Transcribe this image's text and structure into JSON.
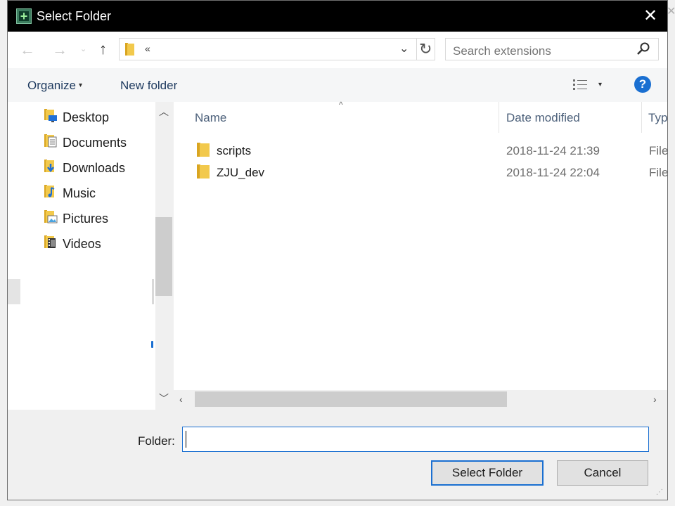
{
  "window": {
    "title": "Select Folder",
    "close_glyph": "✕",
    "app_icon": "plus-icon"
  },
  "nav": {
    "back_glyph": "←",
    "forward_glyph": "→",
    "recent_glyph": "⌄",
    "up_glyph": "↑",
    "address_chevron": "«",
    "address_dropdown_glyph": "⌄",
    "refresh_glyph": "↻",
    "search_placeholder": "Search extensions"
  },
  "toolbar": {
    "organize_label": "Organize",
    "organize_caret": "▾",
    "new_folder_label": "New folder",
    "view_caret": "▾",
    "help_label": "?"
  },
  "navpane": {
    "items": [
      {
        "label": "Desktop",
        "icon": "desktop-icon"
      },
      {
        "label": "Documents",
        "icon": "documents-icon"
      },
      {
        "label": "Downloads",
        "icon": "downloads-icon"
      },
      {
        "label": "Music",
        "icon": "music-icon"
      },
      {
        "label": "Pictures",
        "icon": "pictures-icon"
      },
      {
        "label": "Videos",
        "icon": "videos-icon"
      }
    ],
    "scroll_up_glyph": "︿",
    "scroll_down_glyph": "﹀"
  },
  "content": {
    "columns": {
      "name": "Name",
      "sort_caret": "^",
      "date": "Date modified",
      "type": "Typ"
    },
    "rows": [
      {
        "name": "scripts",
        "date": "2018-11-24 21:39",
        "type": "File"
      },
      {
        "name": "ZJU_dev",
        "date": "2018-11-24 22:04",
        "type": "File"
      }
    ],
    "hscroll_left_glyph": "‹",
    "hscroll_right_glyph": "›"
  },
  "bottom": {
    "folder_label": "Folder:",
    "folder_value": "",
    "select_button": "Select Folder",
    "cancel_button": "Cancel",
    "grip_glyph": "⋰"
  },
  "colors": {
    "accent": "#1a6fd1",
    "folder_yellow": "#f2c94c"
  }
}
